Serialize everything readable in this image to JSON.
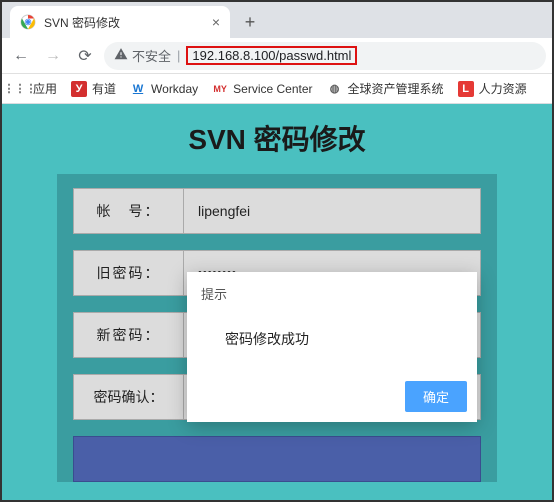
{
  "browser": {
    "tab_title": "SVN 密码修改",
    "new_tab_glyph": "+",
    "close_tab_glyph": "×",
    "nav": {
      "back_glyph": "←",
      "forward_glyph": "→",
      "reload_glyph": "⟳"
    },
    "address": {
      "insecure_label": "不安全",
      "url": "192.168.8.100/passwd.html",
      "url_highlight_color": "#d11"
    },
    "bookmarks": [
      {
        "label": "应用",
        "icon_bg": "",
        "icon_text": "⋮⋮⋮",
        "icon_color": "#f44336"
      },
      {
        "label": "有道",
        "icon_bg": "#d32f2f",
        "icon_text": "У",
        "icon_color": "#fff"
      },
      {
        "label": "Workday",
        "icon_bg": "#fff",
        "icon_text": "W",
        "icon_color": "#1976d2"
      },
      {
        "label": "Service Center",
        "icon_bg": "#fff",
        "icon_text": "MY",
        "icon_color": "#d32f2f"
      },
      {
        "label": "全球资产管理系统",
        "icon_bg": "#fff",
        "icon_text": "◍",
        "icon_color": "#616161"
      },
      {
        "label": "人力资源",
        "icon_bg": "#e53935",
        "icon_text": "L",
        "icon_color": "#fff"
      }
    ]
  },
  "page": {
    "title": "SVN 密码修改",
    "accent_bg": "#4ac0c0",
    "panel_bg": "#3a9da0",
    "fields": {
      "username_label": "帐　号：",
      "username_value": "lipengfei",
      "oldpw_label": "旧密码：",
      "oldpw_value": "••••••••",
      "newpw_label": "新密码：",
      "newpw_value": "",
      "confirm_label": "密码确认：",
      "confirm_value": ""
    }
  },
  "dialog": {
    "title": "提示",
    "message": "密码修改成功",
    "ok_label": "确定",
    "ok_bg": "#4aa3ff"
  }
}
